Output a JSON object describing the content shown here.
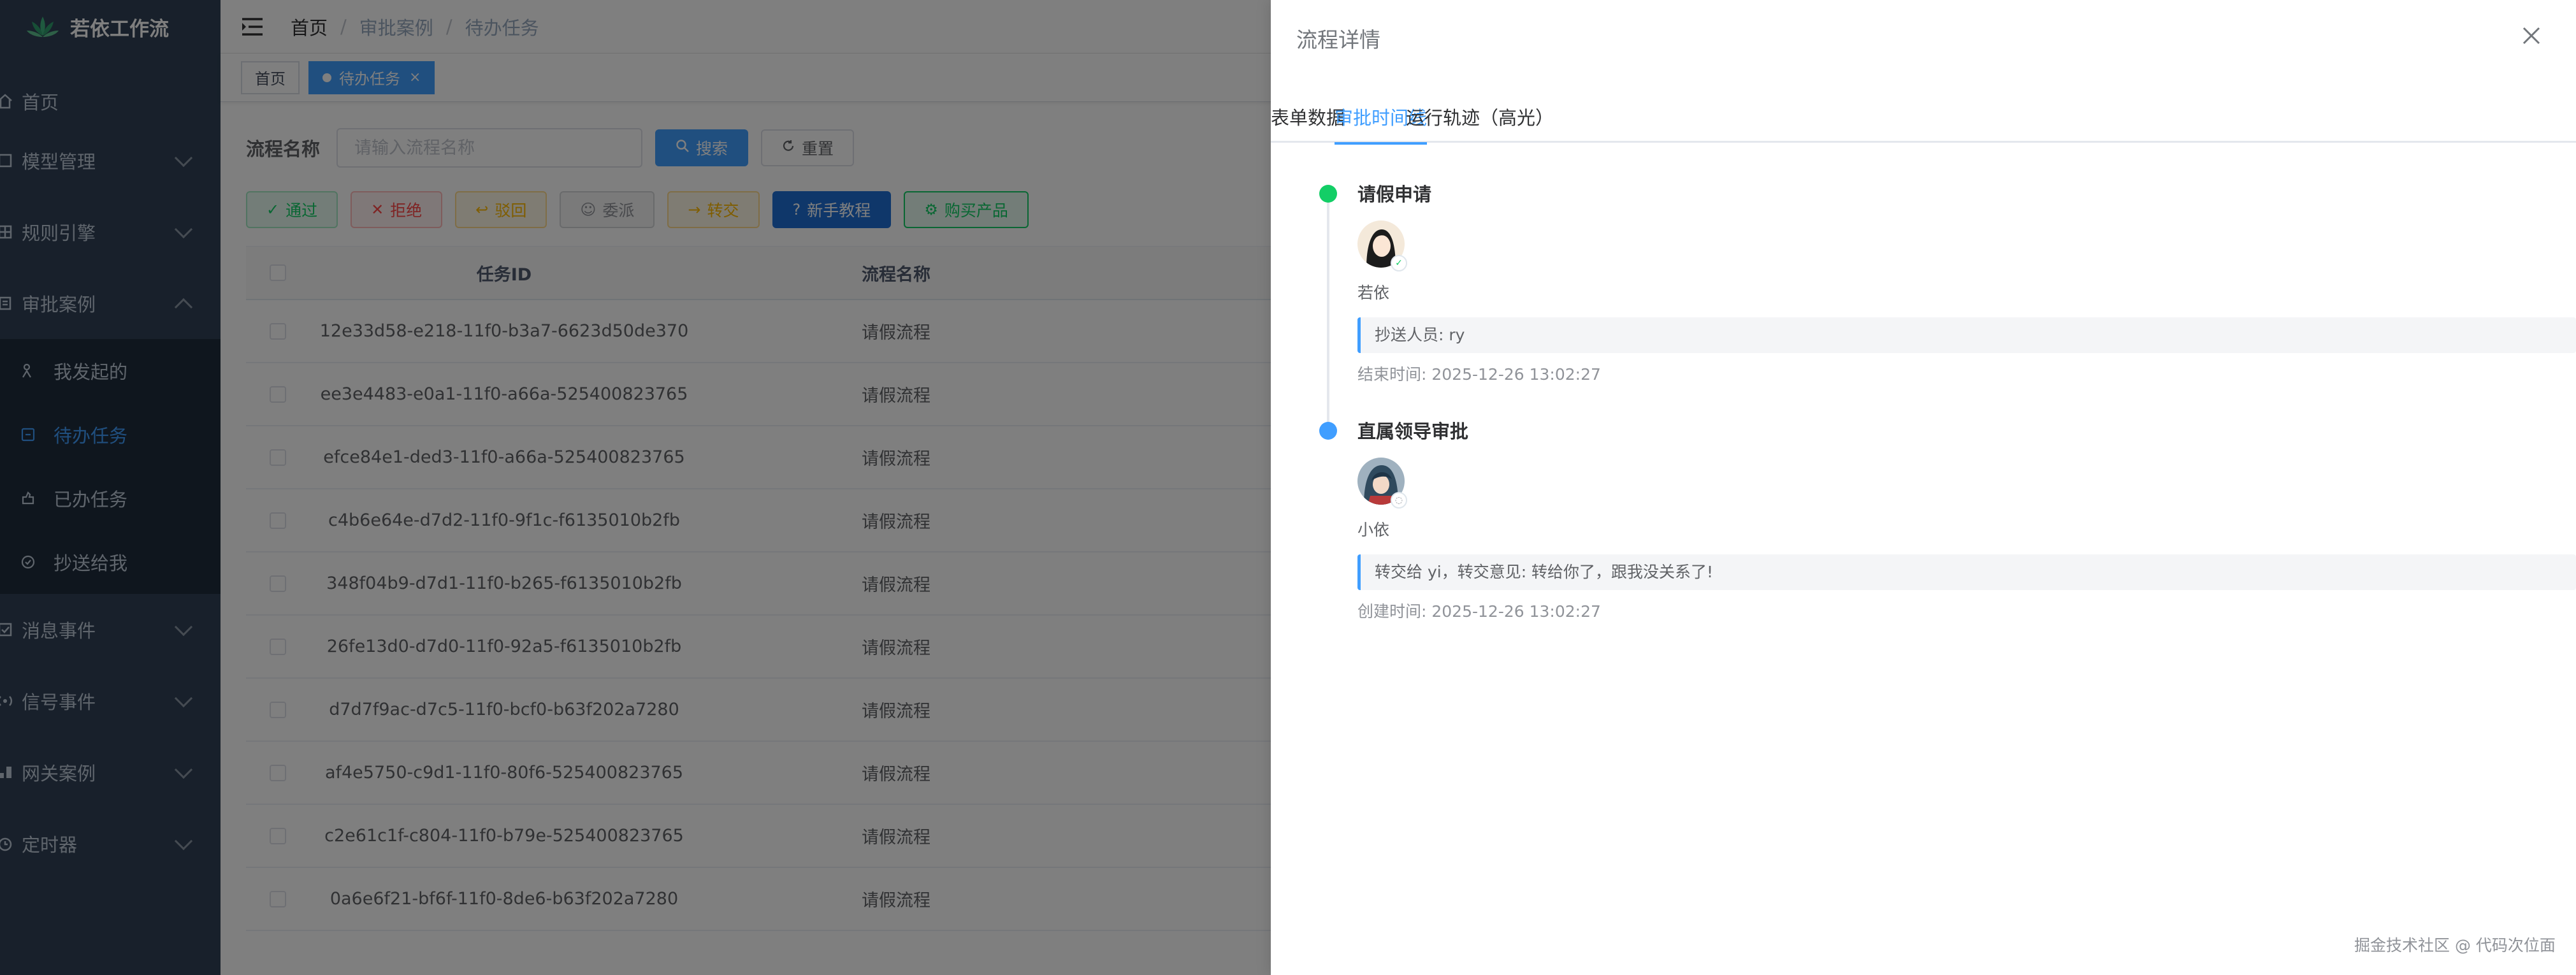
{
  "app": {
    "title": "若依工作流"
  },
  "sidebar": {
    "items": [
      {
        "label": "首页",
        "icon": "home-icon"
      },
      {
        "label": "模型管理",
        "icon": "model-icon",
        "has_children": true
      },
      {
        "label": "规则引擎",
        "icon": "rules-icon",
        "has_children": true
      },
      {
        "label": "审批案例",
        "icon": "approval-icon",
        "has_children": true,
        "expanded": true
      },
      {
        "label": "消息事件",
        "icon": "message-icon",
        "has_children": true
      },
      {
        "label": "信号事件",
        "icon": "signal-icon",
        "has_children": true
      },
      {
        "label": "网关案例",
        "icon": "gateway-icon",
        "has_children": true
      },
      {
        "label": "定时器",
        "icon": "timer-icon",
        "has_children": true
      }
    ],
    "submenu": [
      {
        "label": "我发起的",
        "icon": "user-start-icon"
      },
      {
        "label": "待办任务",
        "icon": "todo-icon",
        "active": true
      },
      {
        "label": "已办任务",
        "icon": "done-icon"
      },
      {
        "label": "抄送给我",
        "icon": "cc-icon"
      }
    ]
  },
  "navbar": {
    "breadcrumb": [
      "首页",
      "审批案例",
      "待办任务"
    ]
  },
  "tags": [
    {
      "label": "首页"
    },
    {
      "label": "待办任务",
      "active": true
    }
  ],
  "search": {
    "label": "流程名称",
    "placeholder": "请输入流程名称",
    "search_btn": "搜索",
    "reset_btn": "重置"
  },
  "toolbar": {
    "pass": "通过",
    "reject": "拒绝",
    "back": "驳回",
    "delegate": "委派",
    "transfer": "转交",
    "tutorial": "新手教程",
    "buy": "购买产品"
  },
  "table": {
    "headers": {
      "task_id": "任务ID",
      "process_name": "流程名称"
    },
    "rows": [
      {
        "task_id": "12e33d58-e218-11f0-b3a7-6623d50de370",
        "process_name": "请假流程"
      },
      {
        "task_id": "ee3e4483-e0a1-11f0-a66a-525400823765",
        "process_name": "请假流程"
      },
      {
        "task_id": "efce84e1-ded3-11f0-a66a-525400823765",
        "process_name": "请假流程"
      },
      {
        "task_id": "c4b6e64e-d7d2-11f0-9f1c-f6135010b2fb",
        "process_name": "请假流程"
      },
      {
        "task_id": "348f04b9-d7d1-11f0-b265-f6135010b2fb",
        "process_name": "请假流程"
      },
      {
        "task_id": "26fe13d0-d7d0-11f0-92a5-f6135010b2fb",
        "process_name": "请假流程"
      },
      {
        "task_id": "d7d7f9ac-d7c5-11f0-bcf0-b63f202a7280",
        "process_name": "请假流程"
      },
      {
        "task_id": "af4e5750-c9d1-11f0-80f6-525400823765",
        "process_name": "请假流程"
      },
      {
        "task_id": "c2e61c1f-c804-11f0-b79e-525400823765",
        "process_name": "请假流程"
      },
      {
        "task_id": "0a6e6f21-bf6f-11f0-8de6-b63f202a7280",
        "process_name": "请假流程"
      }
    ]
  },
  "drawer": {
    "title": "流程详情",
    "tabs": [
      {
        "label": "表单数据"
      },
      {
        "label": "审批时间线",
        "active": true
      },
      {
        "label": "运行轨迹（高光）"
      }
    ],
    "timeline": [
      {
        "title": "请假申请",
        "user": "若依",
        "note": "抄送人员: ry",
        "time": "结束时间: 2025-12-26 13:02:27",
        "dot_color": "#13ce66"
      },
      {
        "title": "直属领导审批",
        "user": "小依",
        "note": "转交给 yi，转交意见: 转给你了，跟我没关系了!",
        "time": "创建时间: 2025-12-26 13:02:27",
        "dot_color": "#409eff"
      }
    ]
  },
  "watermark": "掘金技术社区 @ 代码次位面",
  "colors": {
    "sidebar_bg": "#304156",
    "primary": "#409eff",
    "success": "#13ce66",
    "overlay": "rgba(0,0,0,0.5)"
  }
}
